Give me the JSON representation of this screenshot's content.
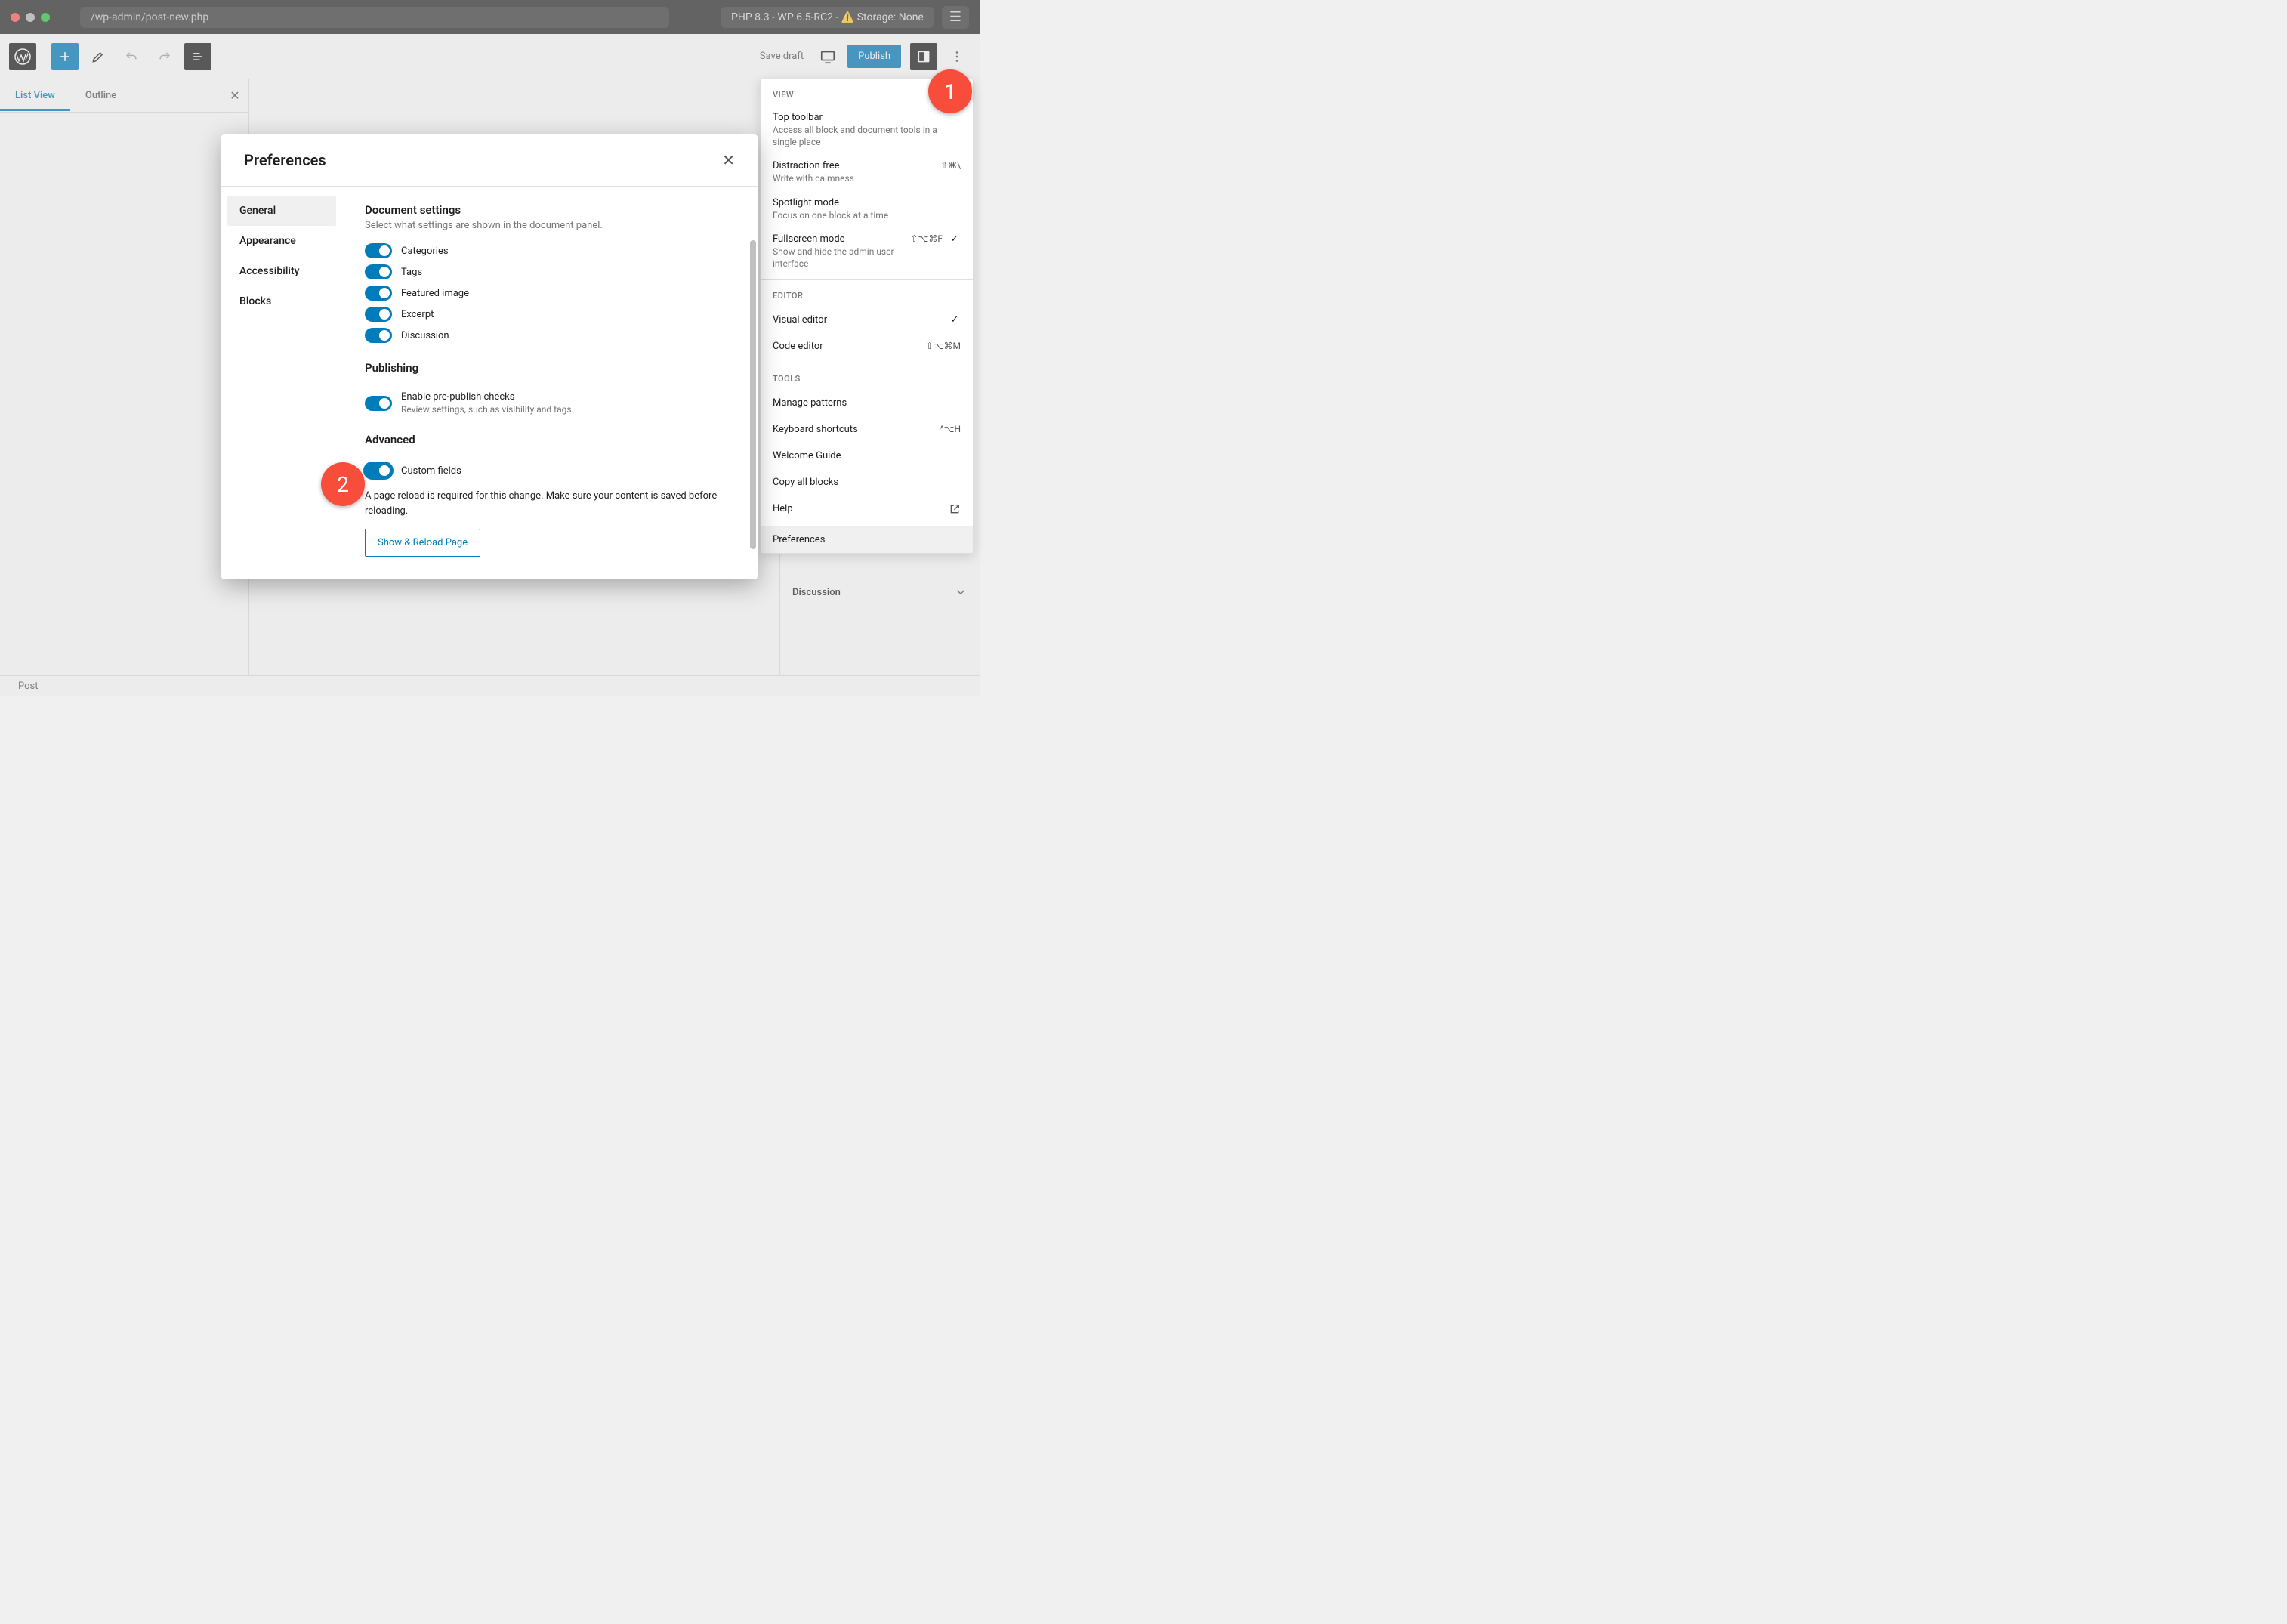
{
  "browser": {
    "url": "/wp-admin/post-new.php",
    "badge": "PHP 8.3 - WP 6.5-RC2 - ⚠️ Storage: None",
    "hamburger": "☰"
  },
  "topbar": {
    "save_draft": "Save draft",
    "publish": "Publish"
  },
  "left_panel": {
    "tab_list_view": "List View",
    "tab_outline": "Outline"
  },
  "footer": {
    "breadcrumb": "Post"
  },
  "dropdown": {
    "section_view": "VIEW",
    "items_view": [
      {
        "title": "Top toolbar",
        "desc": "Access all block and document tools in a single place",
        "shortcut": "",
        "checked": false
      },
      {
        "title": "Distraction free",
        "desc": "Write with calmness",
        "shortcut": "⇧⌘\\",
        "checked": false
      },
      {
        "title": "Spotlight mode",
        "desc": "Focus on one block at a time",
        "shortcut": "",
        "checked": false
      },
      {
        "title": "Fullscreen mode",
        "desc": "Show and hide the admin user interface",
        "shortcut": "⇧⌥⌘F",
        "checked": true
      }
    ],
    "section_editor": "EDITOR",
    "items_editor": [
      {
        "title": "Visual editor",
        "shortcut": "",
        "checked": true
      },
      {
        "title": "Code editor",
        "shortcut": "⇧⌥⌘M",
        "checked": false
      }
    ],
    "section_tools": "TOOLS",
    "items_tools": [
      {
        "title": "Manage patterns",
        "shortcut": ""
      },
      {
        "title": "Keyboard shortcuts",
        "shortcut": "^⌥H"
      },
      {
        "title": "Welcome Guide",
        "shortcut": ""
      },
      {
        "title": "Copy all blocks",
        "shortcut": ""
      },
      {
        "title": "Help",
        "shortcut": "",
        "external": true
      }
    ],
    "preferences": "Preferences"
  },
  "right_sidebar": {
    "discussion": "Discussion"
  },
  "modal": {
    "title": "Preferences",
    "nav": {
      "general": "General",
      "appearance": "Appearance",
      "accessibility": "Accessibility",
      "blocks": "Blocks"
    },
    "sections": {
      "doc_title": "Document settings",
      "doc_desc": "Select what settings are shown in the document panel.",
      "doc_toggles": [
        "Categories",
        "Tags",
        "Featured image",
        "Excerpt",
        "Discussion"
      ],
      "pub_title": "Publishing",
      "pub_toggle_label": "Enable pre-publish checks",
      "pub_toggle_desc": "Review settings, such as visibility and tags.",
      "adv_title": "Advanced",
      "adv_toggle_label": "Custom fields",
      "adv_note": "A page reload is required for this change. Make sure your content is saved before reloading.",
      "reload_btn": "Show & Reload Page"
    }
  },
  "annotations": {
    "a1": "1",
    "a2": "2"
  }
}
